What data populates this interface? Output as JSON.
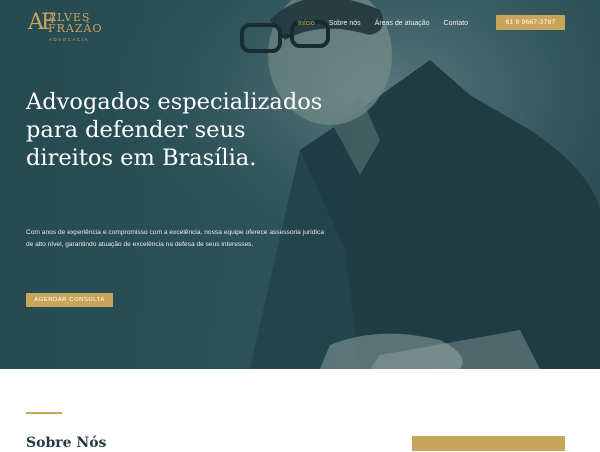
{
  "brand": {
    "mark": "AF",
    "line1": "ALVES",
    "line2": "FRAZÃO",
    "line3": "ADVOCACIA"
  },
  "nav": {
    "items": [
      {
        "label": "Início",
        "active": true
      },
      {
        "label": "Sobre nós",
        "active": false
      },
      {
        "label": "Áreas de atuação",
        "active": false
      },
      {
        "label": "Contato",
        "active": false
      }
    ],
    "phone": "61 9 9667-3787"
  },
  "hero": {
    "headline": "Advogados especializados para defender seus direitos em Brasília.",
    "intro": "Com anos de experiência e compromisso com a excelência, nossa equipe oferece assessoria jurídica de alto nível, garantindo atuação de excelência na defesa de seus interesses.",
    "cta": "AGENDAR CONSULTA"
  },
  "about": {
    "title": "Sobre Nós"
  },
  "colors": {
    "gold": "#c9a55c",
    "teal": "#2f555c",
    "dark_text": "#1f3a40"
  }
}
